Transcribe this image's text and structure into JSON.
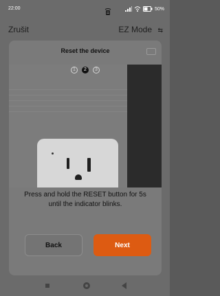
{
  "status_bar": {
    "time": "22:00",
    "battery": "50%",
    "icons": [
      "notification-icon",
      "signal-icon",
      "wifi-icon",
      "battery-icon"
    ]
  },
  "top_bar": {
    "cancel_label": "Zrušit",
    "mode_label": "EZ Mode",
    "mode_icon": "switch-mode-icon"
  },
  "card": {
    "title": "Reset the device",
    "steps": [
      "1",
      "2",
      "3"
    ],
    "active_step": 2,
    "instruction": "Press and hold the RESET button for 5s until the indicator blinks.",
    "back_label": "Back",
    "next_label": "Next"
  },
  "colors": {
    "accent": "#dd5b12",
    "overlay_bg": "#6b6b6b"
  }
}
